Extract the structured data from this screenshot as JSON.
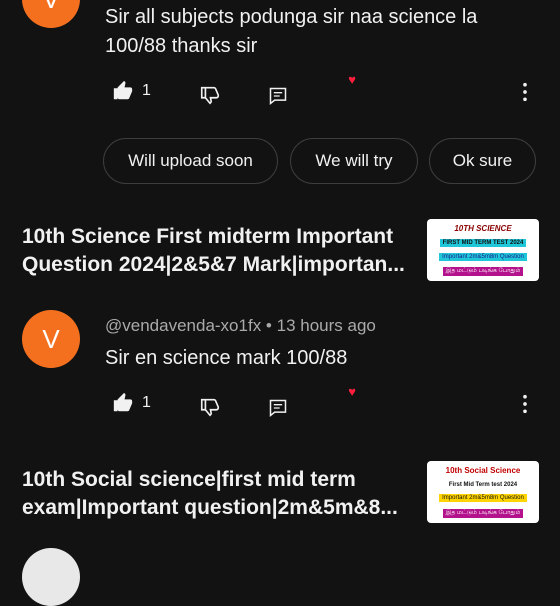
{
  "comment1": {
    "avatar_letter": "V",
    "text_line1": "Sir all subjects podunga sir naa science la",
    "text_line2": "100/88 thanks sir",
    "likes": "1"
  },
  "replies": {
    "chips": [
      "Will upload soon",
      "We will try",
      "Ok sure"
    ]
  },
  "video1": {
    "title_line1": "10th Science First midterm Important",
    "title_line2": "Question 2024|2&5&7 Mark|importan...",
    "thumb": {
      "line1": "10TH SCIENCE",
      "line2": "FIRST MID TERM TEST 2024",
      "line3": "Important 2m&5m8m Question",
      "line4": "இத மட்டும் படிங்க போதும்"
    }
  },
  "comment2": {
    "avatar_letter": "V",
    "author": "@vendavenda-xo1fx",
    "time": "13 hours ago",
    "text": "Sir en science mark 100/88",
    "likes": "1"
  },
  "video2": {
    "title_line1": "10th Social science|first mid term",
    "title_line2": "exam|Important question|2m&5m&8...",
    "thumb": {
      "line1": "10th Social Science",
      "line2": "First Mid Term test 2024",
      "line3": "Important 2m&5m8m Question",
      "line4": "இத மட்டும் படிங்க போதும்"
    }
  },
  "colors": {
    "background": "#121212",
    "avatar": "#f4701f",
    "heart": "#ff1e3c"
  }
}
